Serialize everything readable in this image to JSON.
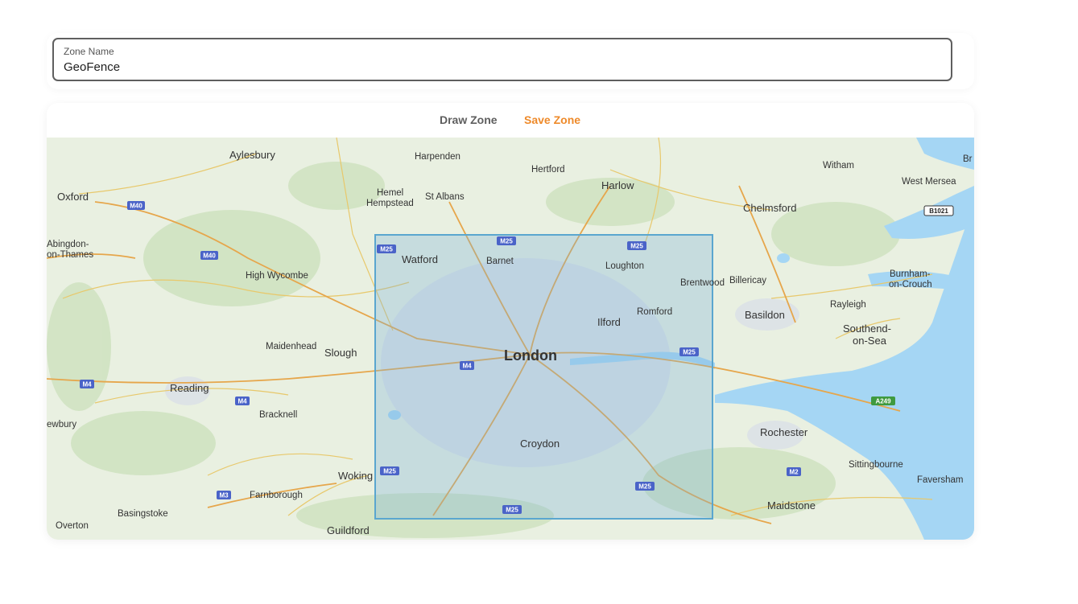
{
  "zone_field": {
    "label": "Zone Name",
    "value": "GeoFence"
  },
  "tabs": {
    "draw": "Draw Zone",
    "save": "Save Zone"
  },
  "colors": {
    "accent": "#ee8a2a",
    "zone_stroke": "#5aa6cf",
    "water": "#a5d6f4",
    "land": "#e9f0e1",
    "road_major": "#e6a64b",
    "road_minor": "#e8c86b",
    "motorway_shield": "#4a63c8"
  },
  "map": {
    "labels": {
      "aylesbury": "Aylesbury",
      "harpenden": "Harpenden",
      "hertford": "Hertford",
      "harlow": "Harlow",
      "witham": "Witham",
      "west_mersea": "West Mersea",
      "br": "Br",
      "oxford": "Oxford",
      "hemel1": "Hemel",
      "hemel2": "Hempstead",
      "st_albans": "St Albans",
      "chelmsford": "Chelmsford",
      "abingdon1": "Abingdon-",
      "abingdon2": "on-Thames",
      "watford": "Watford",
      "barnet": "Barnet",
      "loughton": "Loughton",
      "high_wycombe": "High Wycombe",
      "brentwood": "Brentwood",
      "billericay": "Billericay",
      "burnham1": "Burnham-",
      "burnham2": "on-Crouch",
      "romford": "Romford",
      "rayleigh": "Rayleigh",
      "basildon": "Basildon",
      "ilford": "Ilford",
      "southend1": "Southend-",
      "southend2": "on-Sea",
      "maidenhead": "Maidenhead",
      "slough": "Slough",
      "london": "London",
      "reading": "Reading",
      "bracknell": "Bracknell",
      "newbury": "ewbury",
      "croydon": "Croydon",
      "rochester": "Rochester",
      "woking": "Woking",
      "sittingbourne": "Sittingbourne",
      "farnborough": "Farnborough",
      "faversham": "Faversham",
      "basingstoke": "Basingstoke",
      "maidstone": "Maidstone",
      "overton": "Overton",
      "guildford": "Guildford"
    },
    "shields": {
      "m40a": "M40",
      "m40b": "M40",
      "m4a": "M4",
      "m4b": "M4",
      "m4c": "M4",
      "m3": "M3",
      "m2": "M2",
      "m25_watford": "M25",
      "m25_barnet": "M25",
      "m25_ne": "M25",
      "m25_e": "M25",
      "m25_sw": "M25",
      "m25_s": "M25",
      "m25_se": "M25",
      "a249": "A249",
      "b1021": "B1021"
    }
  }
}
